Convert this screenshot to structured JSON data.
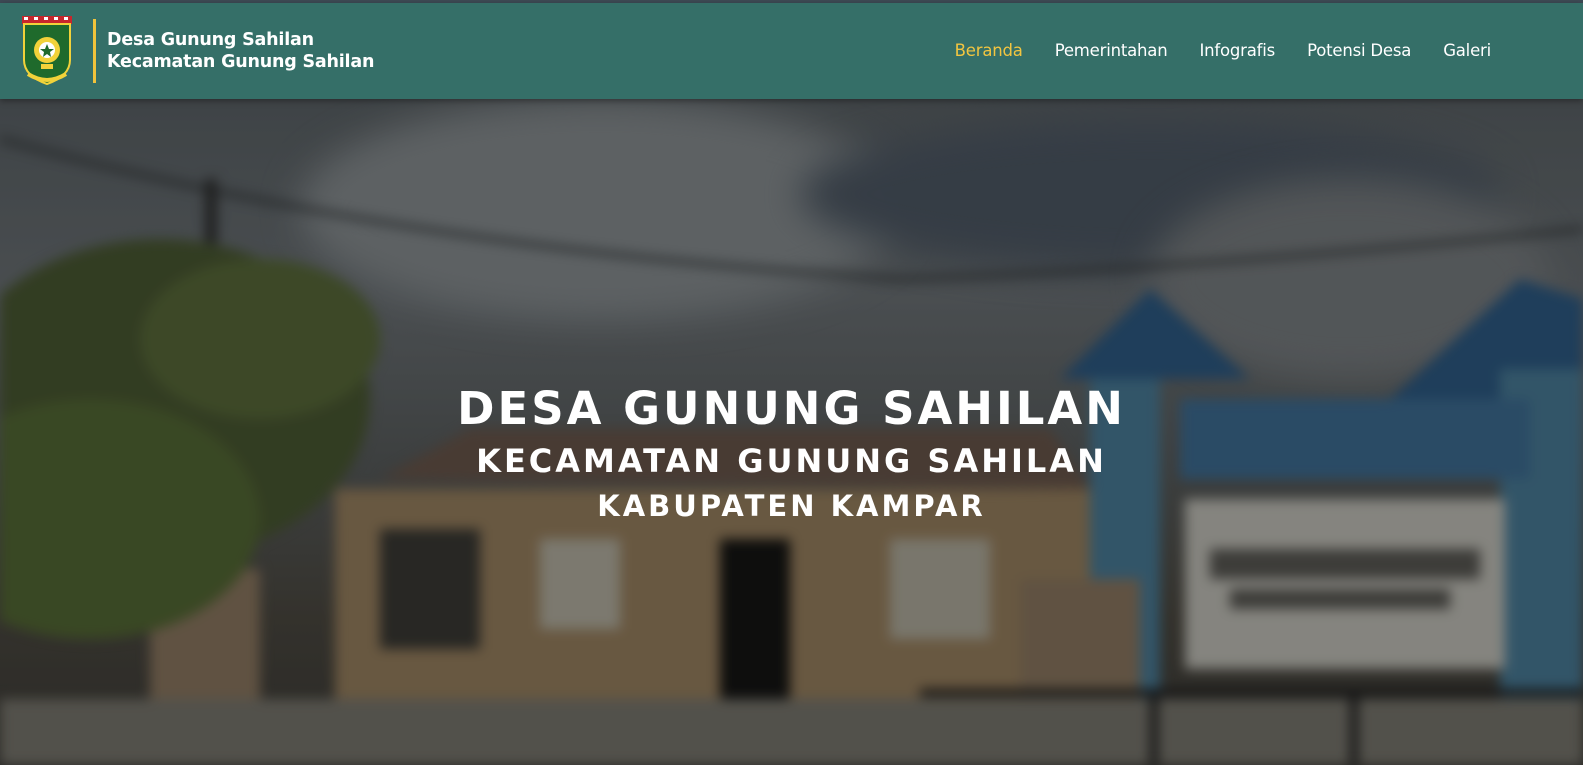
{
  "header": {
    "title_line1": "Desa Gunung Sahilan",
    "title_line2": "Kecamatan Gunung Sahilan",
    "logo_icon": "regency-emblem-icon"
  },
  "nav": {
    "items": [
      {
        "label": "Beranda",
        "active": true
      },
      {
        "label": "Pemerintahan",
        "active": false
      },
      {
        "label": "Infografis",
        "active": false
      },
      {
        "label": "Potensi Desa",
        "active": false
      },
      {
        "label": "Galeri",
        "active": false
      }
    ]
  },
  "hero": {
    "line1": "DESA GUNUNG SAHILAN",
    "line2": "KECAMATAN GUNUNG SAHILAN",
    "line3": "KABUPATEN KAMPAR"
  },
  "colors": {
    "navbar": "#356f68",
    "accent": "#f2c540",
    "text": "#ffffff"
  }
}
